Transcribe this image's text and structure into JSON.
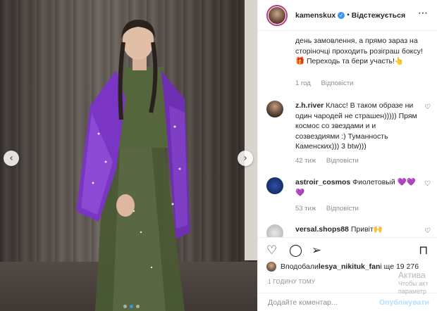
{
  "post": {
    "username": "kamenskux",
    "verified_icon": "verified-badge-icon",
    "separator": "•",
    "follow_label": "Відстежується",
    "more_icon": "more-options-icon",
    "caption": "день замовлення, а прямо зараз на сторіночці проходить розіграш боксу!🎁 Переходь та бери участь!👆",
    "caption_time": "1 год",
    "caption_reply": "Відповісти"
  },
  "comments": [
    {
      "username": "z.h.river",
      "text": "Класс! В таком образе ни один чародей не страшен))))) Прям космос со звездами и и созвездиями :) Туманность Каменских))) 3 btw)))",
      "time": "42 тиж",
      "reply": "Відповісти"
    },
    {
      "username": "astroir_cosmos",
      "text": "Фиолетовый 💜💜💜",
      "time": "53 тиж",
      "reply": "Відповісти"
    },
    {
      "username": "versal.shops88",
      "text": "Привіт🙌",
      "time": "",
      "reply": ""
    }
  ],
  "actions": {
    "like_icon": "heart-icon",
    "comment_icon": "comment-icon",
    "share_icon": "share-icon",
    "save_icon": "bookmark-icon"
  },
  "likes": {
    "prefix": "Вподобали ",
    "user": "lesya_nikituk_fan",
    "suffix": " і ще 19 276"
  },
  "timestamp": "1 ГОДИНУ ТОМУ",
  "add_comment": {
    "placeholder": "Додайте коментар...",
    "publish_label": "Опублікувати"
  },
  "watermark": {
    "title": "Актива",
    "line1": "Чтобы акт",
    "line2": "параметр"
  },
  "colors": {
    "accent": "#3897f0",
    "dress": "#4a5a34",
    "jacket": "#7b35c4"
  }
}
